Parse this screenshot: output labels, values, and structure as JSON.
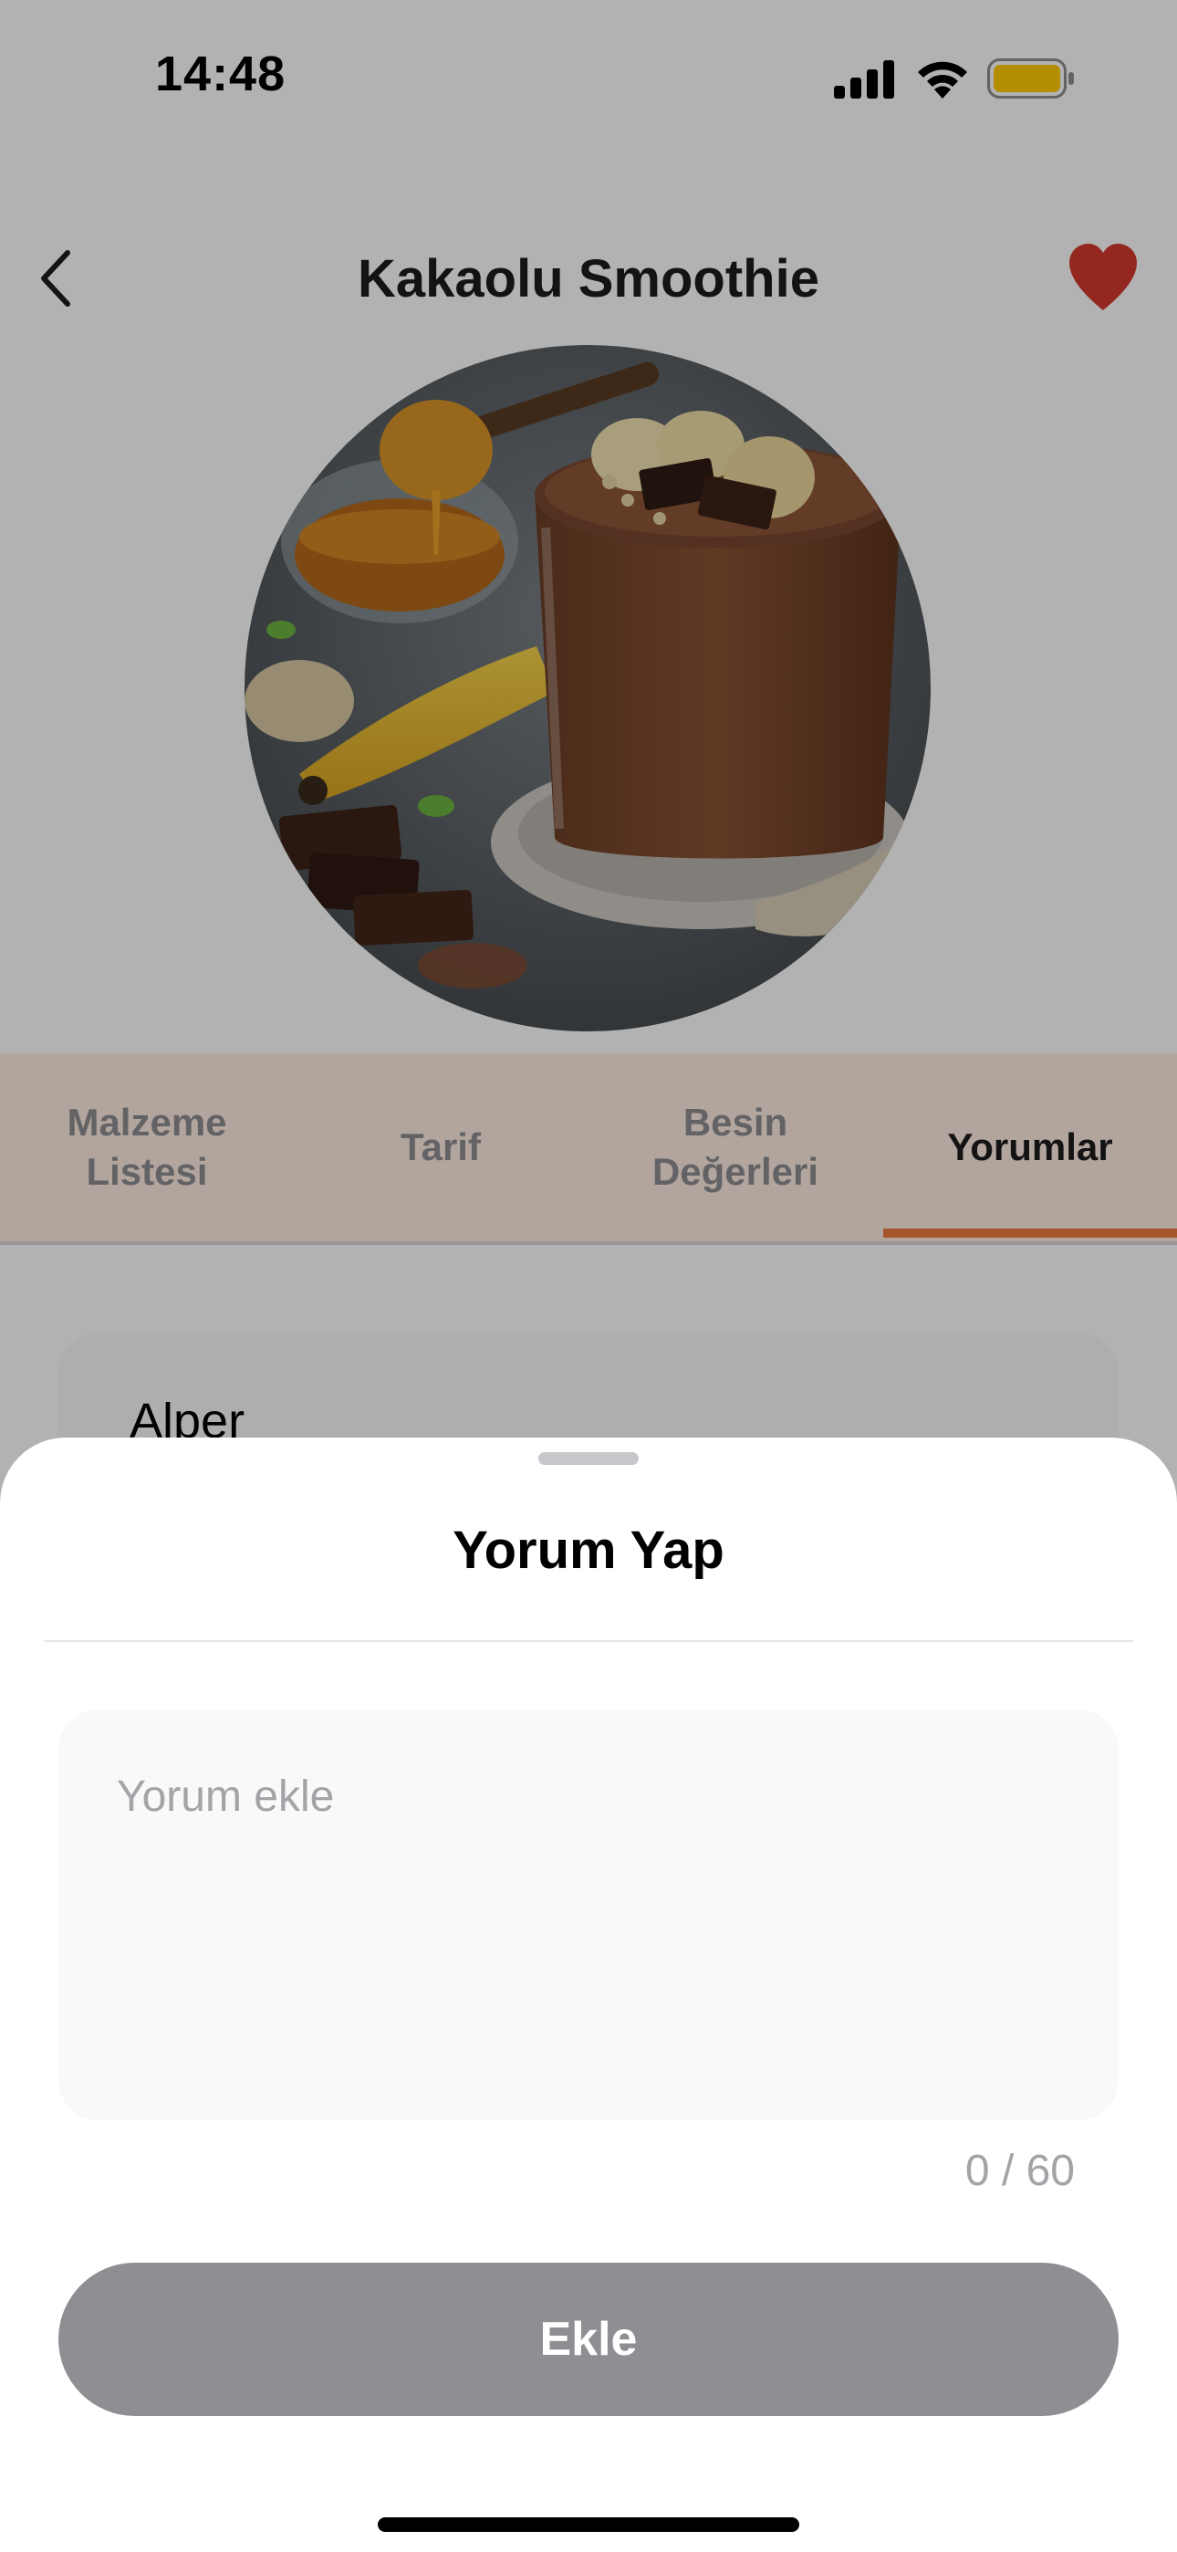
{
  "status_bar": {
    "time": "14:48",
    "icons": [
      "signal-icon",
      "wifi-icon",
      "battery-icon"
    ],
    "battery_color": "#ffcc00"
  },
  "header": {
    "title": "Kakaolu Smoothie",
    "back_icon": "chevron-left-icon",
    "favorite_icon": "heart-icon",
    "favorite_color": "#d43a2f"
  },
  "hero": {
    "image": "chocolate-smoothie-photo"
  },
  "tabs": [
    {
      "label_line1": "Malzeme",
      "label_line2": "Listesi",
      "active": false
    },
    {
      "label_line1": "Tarif",
      "label_line2": "",
      "active": false
    },
    {
      "label_line1": "Besin",
      "label_line2": "Değerleri",
      "active": false
    },
    {
      "label_line1": "Yorumlar",
      "label_line2": "",
      "active": true
    }
  ],
  "accent_color": "#f07a40",
  "comments": [
    {
      "author": "Alper"
    }
  ],
  "sheet": {
    "title": "Yorum Yap",
    "input_placeholder": "Yorum ekle",
    "input_value": "",
    "char_counter": "0 / 60",
    "submit_label": "Ekle"
  }
}
